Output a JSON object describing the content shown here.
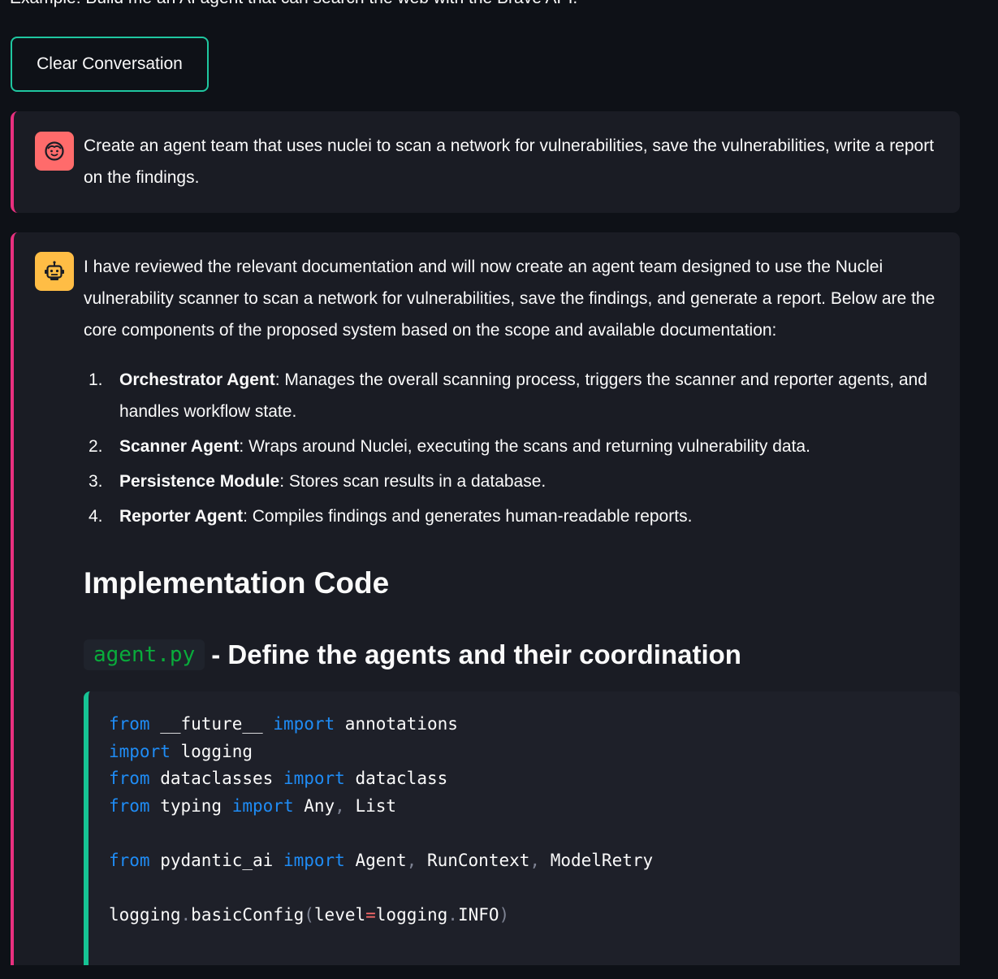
{
  "top_hint": "Example: Build me an AI agent that can search the web with the Brave API.",
  "clear_button_label": "Clear Conversation",
  "user_message": {
    "text": "Create an agent team that uses nuclei to scan a network for vulnerabilities, save the vulnerabilities, write a report on the findings."
  },
  "assistant_message": {
    "intro": "I have reviewed the relevant documentation and will now create an agent team designed to use the Nuclei vulnerability scanner to scan a network for vulnerabilities, save the findings, and generate a report. Below are the core components of the proposed system based on the scope and available documentation:",
    "components": [
      {
        "num": "1.",
        "title": "Orchestrator Agent",
        "desc": ": Manages the overall scanning process, triggers the scanner and reporter agents, and handles workflow state."
      },
      {
        "num": "2.",
        "title": "Scanner Agent",
        "desc": ": Wraps around Nuclei, executing the scans and returning vulnerability data."
      },
      {
        "num": "3.",
        "title": "Persistence Module",
        "desc": ": Stores scan results in a database."
      },
      {
        "num": "4.",
        "title": "Reporter Agent",
        "desc": ": Compiles findings and generates human-readable reports."
      }
    ],
    "section_heading": "Implementation Code",
    "file_heading": {
      "filename": "agent.py",
      "text": "- Define the agents and their coordination"
    },
    "code": {
      "l1": {
        "kw1": "from",
        "mod": " __future__ ",
        "kw2": "import",
        "name": " annotations"
      },
      "l2": {
        "kw1": "import",
        "mod": " logging"
      },
      "l3": {
        "kw1": "from",
        "mod": " dataclasses ",
        "kw2": "import",
        "name": " dataclass"
      },
      "l4": {
        "kw1": "from",
        "mod": " typing ",
        "kw2": "import",
        "a": " Any",
        "comma": ",",
        "b": " List"
      },
      "l5": {
        "kw1": "from",
        "mod": " pydantic_ai ",
        "kw2": "import",
        "a": " Agent",
        "c1": ",",
        "b": " RunContext",
        "c2": ",",
        "c": " ModelRetry"
      },
      "l6": {
        "a": "logging",
        "dot1": ".",
        "b": "basicConfig",
        "p1": "(",
        "c": "level",
        "eq": "=",
        "d": "logging",
        "dot2": ".",
        "e": "INFO",
        "p2": ")"
      }
    }
  },
  "colors": {
    "background": "#0e1117",
    "message_bg": "#1a1c24",
    "accent_border": "#e8307f",
    "button_border": "#1fc7a0",
    "code_border": "#16c394",
    "user_avatar": "#ff6b6b",
    "assistant_avatar": "#ffbd45",
    "keyword": "#1f8cf5",
    "inline_code": "#09ab3b"
  },
  "icons": {
    "user_avatar": "user-face-icon",
    "assistant_avatar": "robot-icon"
  }
}
